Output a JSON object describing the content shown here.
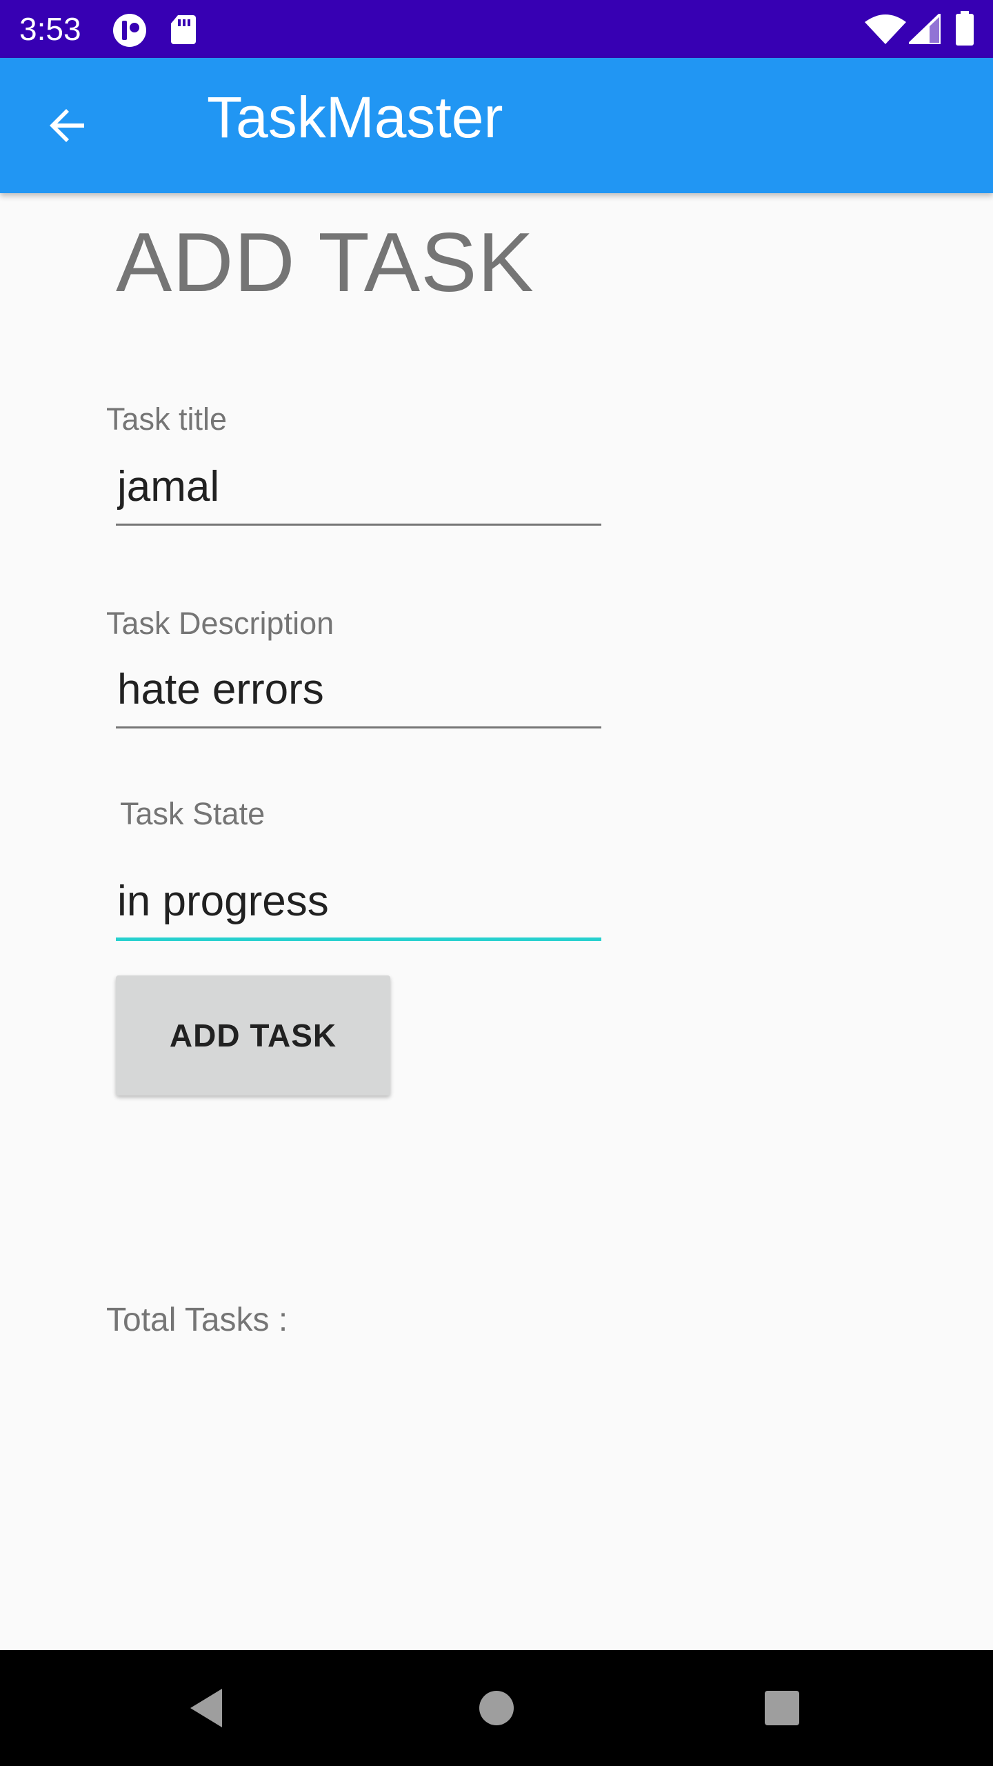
{
  "status_bar": {
    "time": "3:53",
    "icons": [
      "notification-app-icon",
      "sd-card-icon",
      "wifi-icon",
      "cell-signal-icon",
      "battery-icon"
    ]
  },
  "app_bar": {
    "title": "TaskMaster",
    "back_icon": "arrow-back-icon",
    "background": "#2196f3"
  },
  "page": {
    "heading": "ADD TASK"
  },
  "form": {
    "title_label": "Task title",
    "title_value": "jamal",
    "description_label": "Task Description",
    "description_value": "hate errors",
    "state_label": "Task State",
    "state_value": "in progress",
    "submit_label": "ADD TASK"
  },
  "footer": {
    "total_label": "Total Tasks :"
  },
  "nav_bar": {
    "icons": [
      "back-triangle-icon",
      "home-circle-icon",
      "recents-square-icon"
    ]
  },
  "colors": {
    "status_bar": "#3700b3",
    "accent_underline": "#26d0ce",
    "button": "#d6d7d7"
  }
}
